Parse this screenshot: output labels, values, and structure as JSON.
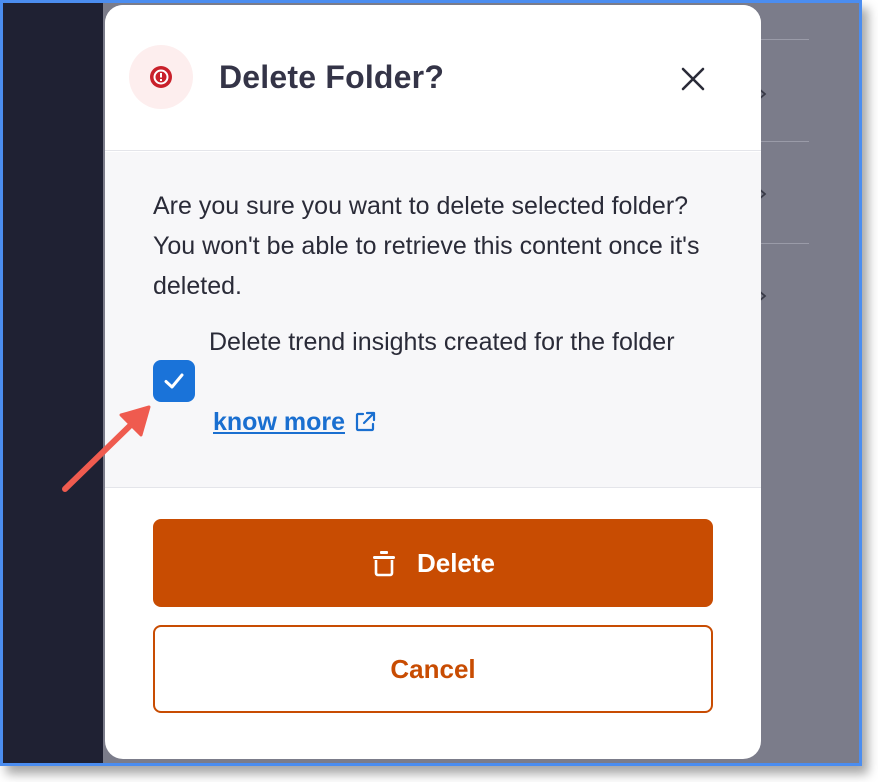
{
  "dialog": {
    "title": "Delete Folder?",
    "message": "Are you sure you want to delete selected folder? You won't be able to retrieve this content once it's deleted.",
    "checkbox_label": "Delete trend insights created for the folder",
    "checkbox_checked": true,
    "link_text": "know more",
    "delete_label": "Delete",
    "cancel_label": "Cancel"
  },
  "icons": {
    "warning": "alert-circle-icon",
    "close": "close-icon",
    "check": "checkmark-icon",
    "external": "external-link-icon",
    "trash": "trash-icon",
    "annotation": "arrow-icon"
  },
  "colors": {
    "primary_action": "#c84c02",
    "checkbox": "#1a73d9",
    "link": "#1a6fd0",
    "warning": "#c9202a",
    "annotation_arrow": "#ef5b4f",
    "overlay": "#7b7c8a",
    "left_rail": "#1f2133"
  }
}
